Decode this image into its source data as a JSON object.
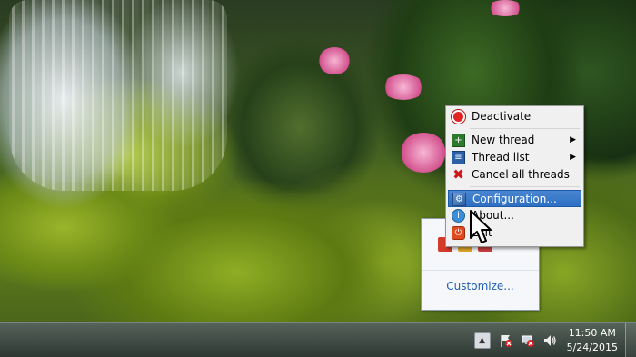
{
  "context_menu": {
    "items": [
      {
        "label": "Deactivate",
        "icon": "deactivate-icon"
      },
      {
        "label": "New thread",
        "icon": "new-thread-icon",
        "submenu": true
      },
      {
        "label": "Thread list",
        "icon": "thread-list-icon",
        "submenu": true
      },
      {
        "label": "Cancel all threads",
        "icon": "cancel-icon"
      },
      {
        "label": "Configuration...",
        "icon": "configuration-icon",
        "highlighted": true
      },
      {
        "label": "About...",
        "icon": "about-icon"
      },
      {
        "label": "Exit",
        "icon": "exit-icon"
      }
    ],
    "submenu_arrow": "▶"
  },
  "tray_popup": {
    "customize_label": "Customize..."
  },
  "taskbar": {
    "clock_time": "11:50 AM",
    "clock_date": "5/24/2015",
    "show_hidden_arrow": "▲"
  },
  "colors": {
    "menu_highlight": "#2d6fc4",
    "link": "#1f5fb4"
  }
}
